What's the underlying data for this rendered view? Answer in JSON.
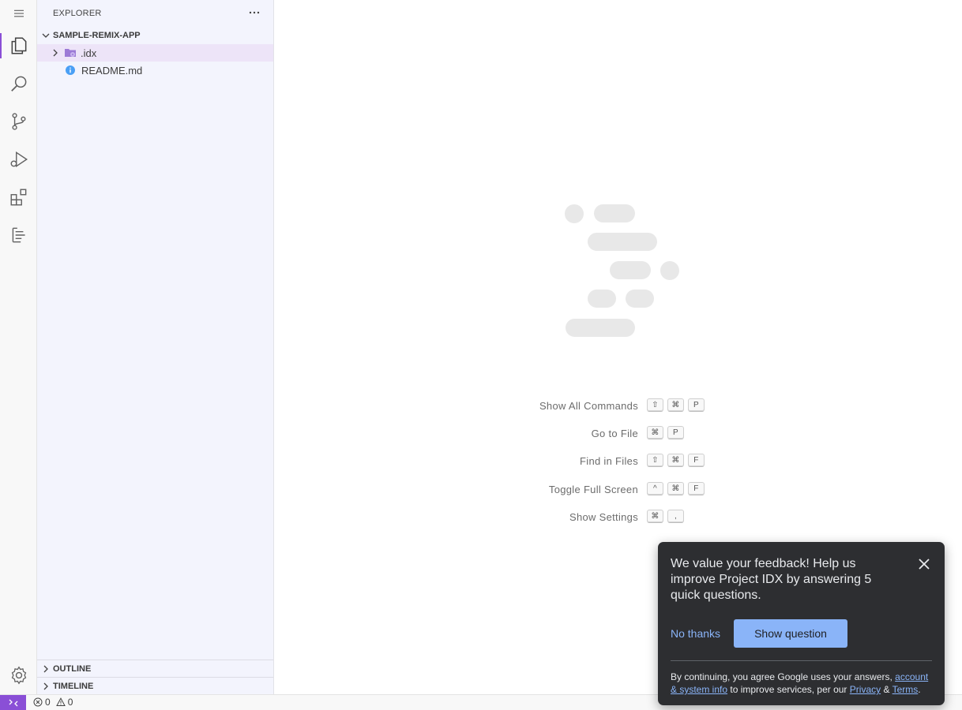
{
  "sidebar": {
    "title": "EXPLORER",
    "project": "SAMPLE-REMIX-APP",
    "items": [
      {
        "label": ".idx",
        "type": "folder"
      },
      {
        "label": "README.md",
        "type": "file"
      }
    ],
    "outline_label": "OUTLINE",
    "timeline_label": "TIMELINE"
  },
  "activity_bar": {
    "items": [
      "explorer-icon",
      "search-icon",
      "source-control-icon",
      "run-debug-icon",
      "extensions-icon",
      "outline-list-icon"
    ],
    "settings": "gear-icon"
  },
  "shortcuts": [
    {
      "label": "Show All Commands",
      "keys": [
        "⇧",
        "⌘",
        "P"
      ]
    },
    {
      "label": "Go to File",
      "keys": [
        "⌘",
        "P"
      ]
    },
    {
      "label": "Find in Files",
      "keys": [
        "⇧",
        "⌘",
        "F"
      ]
    },
    {
      "label": "Toggle Full Screen",
      "keys": [
        "^",
        "⌘",
        "F"
      ]
    },
    {
      "label": "Show Settings",
      "keys": [
        "⌘",
        ","
      ]
    }
  ],
  "status": {
    "errors": "0",
    "warnings": "0"
  },
  "toast": {
    "message": "We value your feedback! Help us improve Project IDX by answering 5 quick questions.",
    "no_thanks": "No thanks",
    "show_question": "Show question",
    "legal_prefix": "By continuing, you agree Google uses your answers,",
    "legal_link1": "account & system info",
    "legal_middle": "to improve services, per our",
    "legal_link2": "Privacy",
    "legal_amp": "&",
    "legal_link3": "Terms",
    "legal_suffix": "."
  },
  "colors": {
    "accent": "#8a4fd6",
    "sidebar_bg": "#f3f4fd",
    "toast_bg": "#2d2e31",
    "toast_button": "#8ab4f8"
  }
}
